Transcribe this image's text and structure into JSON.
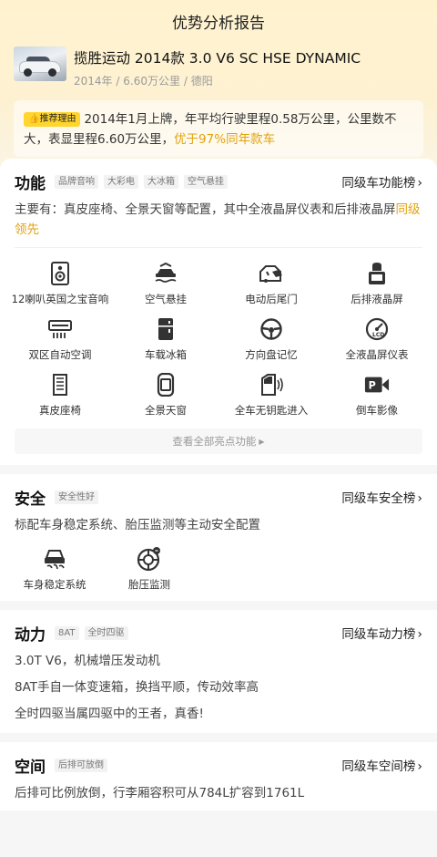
{
  "header": {
    "title": "优势分析报告"
  },
  "car": {
    "name": "揽胜运动 2014款 3.0 V6 SC HSE DYNAMIC",
    "year": "2014年",
    "mileage": "6.60万公里",
    "city": "德阳",
    "sep": "/"
  },
  "reason": {
    "badge": "推荐理由",
    "text": "2014年1月上牌，年平均行驶里程0.58万公里，公里数不大，表显里程6.60万公里，",
    "highlight": "优于97%同年款车"
  },
  "function": {
    "title": "功能",
    "tags": [
      "品牌音响",
      "大彩电",
      "大冰箱",
      "空气悬挂"
    ],
    "rank": "同级车功能榜",
    "desc": "主要有：真皮座椅、全景天窗等配置，其中全液晶屏仪表和后排液晶屏",
    "desc_hl": "同级领先",
    "items": [
      {
        "label": "12喇叭英国之宝音响",
        "icon": "speaker-icon"
      },
      {
        "label": "空气悬挂",
        "icon": "air-suspension-icon"
      },
      {
        "label": "电动后尾门",
        "icon": "power-tailgate-icon"
      },
      {
        "label": "后排液晶屏",
        "icon": "rear-screen-icon"
      },
      {
        "label": "双区自动空调",
        "icon": "air-conditioner-icon"
      },
      {
        "label": "车载冰箱",
        "icon": "fridge-icon"
      },
      {
        "label": "方向盘记忆",
        "icon": "steering-wheel-icon"
      },
      {
        "label": "全液晶屏仪表",
        "icon": "lcd-dashboard-icon"
      },
      {
        "label": "真皮座椅",
        "icon": "leather-seat-icon"
      },
      {
        "label": "全景天窗",
        "icon": "panoramic-sunroof-icon"
      },
      {
        "label": "全车无钥匙进入",
        "icon": "keyless-entry-icon"
      },
      {
        "label": "倒车影像",
        "icon": "reverse-camera-icon"
      }
    ],
    "more": "查看全部亮点功能"
  },
  "safety": {
    "title": "安全",
    "tag": "安全性好",
    "rank": "同级车安全榜",
    "desc": "标配车身稳定系统、胎压监测等主动安全配置",
    "items": [
      {
        "label": "车身稳定系统",
        "icon": "stability-control-icon"
      },
      {
        "label": "胎压监测",
        "icon": "tire-pressure-icon"
      }
    ]
  },
  "power": {
    "title": "动力",
    "tags": [
      "8AT",
      "全时四驱"
    ],
    "rank": "同级车动力榜",
    "lines": [
      "3.0T V6，机械增压发动机",
      "8AT手自一体变速箱，换挡平顺，传动效率高",
      "全时四驱当属四驱中的王者，真香!"
    ]
  },
  "space": {
    "title": "空间",
    "tag": "后排可放倒",
    "rank": "同级车空间榜",
    "desc": "后排可比例放倒，行李厢容积可从784L扩容到1761L"
  },
  "colors": {
    "accent": "#e3a20b",
    "badge": "#ffd52e",
    "icon": "#333333"
  }
}
